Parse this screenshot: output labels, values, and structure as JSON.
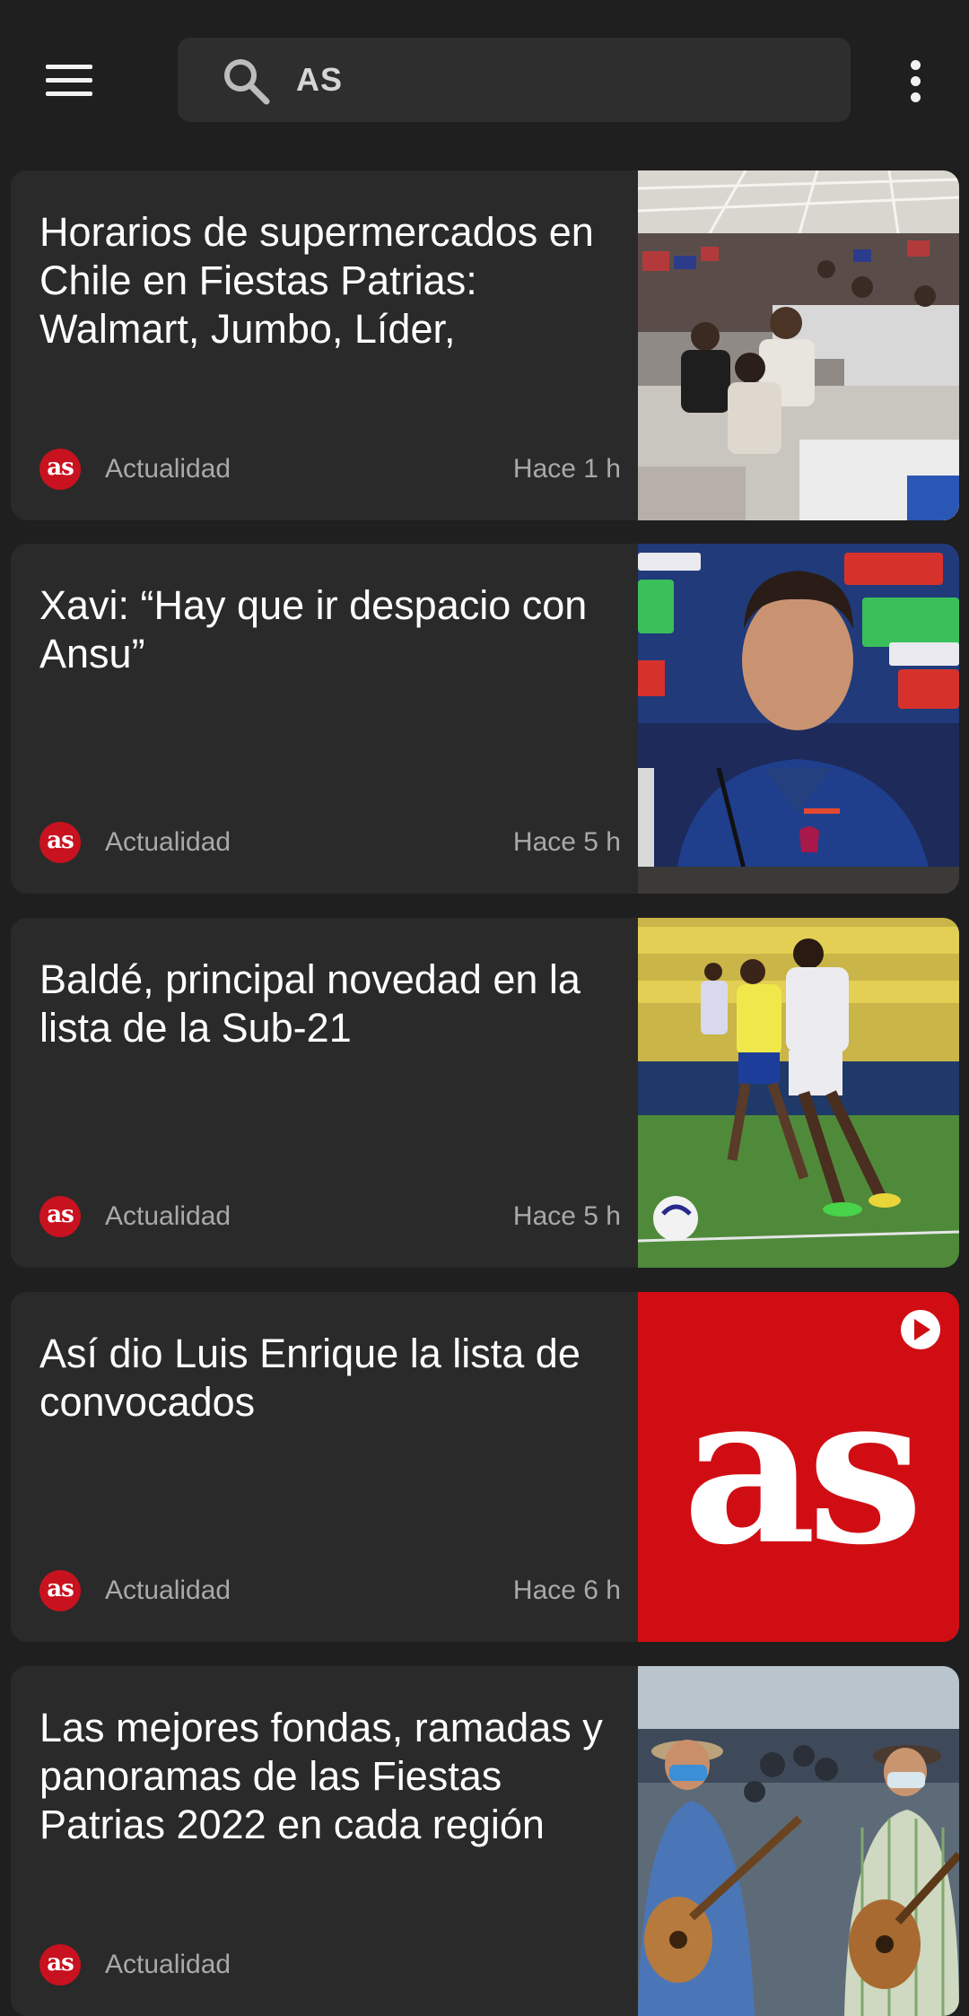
{
  "search": {
    "query": "AS"
  },
  "colors": {
    "background": "#1f1f1f",
    "card": "#2a2a2a",
    "brand": "#c8121f",
    "meta_text": "#a9a9a9"
  },
  "articles": [
    {
      "title": "Horarios de supermercados en Chile en Fiestas Patrias: Walmart, Jumbo, Líder,",
      "source_logo": "as",
      "source": "Actualidad",
      "time": "Hace 1 h"
    },
    {
      "title": "Xavi: “Hay que ir despacio con Ansu”",
      "source_logo": "as",
      "source": "Actualidad",
      "time": "Hace 5 h"
    },
    {
      "title": "Baldé, principal novedad en la lista de la Sub-21",
      "source_logo": "as",
      "source": "Actualidad",
      "time": "Hace 5 h"
    },
    {
      "title": "Así dio Luis Enrique la lista de convocados",
      "source_logo": "as",
      "source": "Actualidad",
      "time": "Hace 6 h",
      "thumb_logo": "as",
      "play_icon": "play-circle-icon"
    },
    {
      "title": "Las mejores fondas, ramadas y panoramas de las Fiestas Patrias 2022 en cada región",
      "source_logo": "as",
      "source": "Actualidad",
      "time": ""
    }
  ]
}
